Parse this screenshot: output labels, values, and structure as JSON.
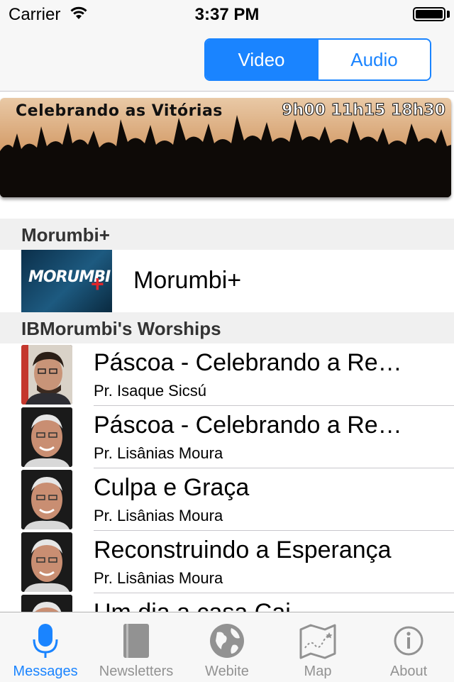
{
  "status_bar": {
    "carrier": "Carrier",
    "time": "3:37 PM"
  },
  "nav": {
    "segments": [
      "Video",
      "Audio"
    ],
    "selected": "Video"
  },
  "banner": {
    "title": "Celebrando as Vitórias",
    "times": "9h00 11h15 18h30"
  },
  "sections": [
    {
      "header": "Morumbi+",
      "items": [
        {
          "title": "Morumbi+",
          "thumb_text": "MORUMBI"
        }
      ]
    },
    {
      "header": "IBMorumbi's Worships",
      "items": [
        {
          "title": "Páscoa - Celebrando a Re…",
          "speaker": "Pr. Isaque Sicsú"
        },
        {
          "title": "Páscoa - Celebrando a Re…",
          "speaker": "Pr. Lisânias Moura"
        },
        {
          "title": "Culpa e Graça",
          "speaker": "Pr. Lisânias Moura"
        },
        {
          "title": "Reconstruindo a Esperança",
          "speaker": "Pr. Lisânias Moura"
        },
        {
          "title": "Um dia a casa Cai",
          "speaker": ""
        }
      ]
    }
  ],
  "tab_bar": {
    "items": [
      {
        "label": "Messages",
        "icon": "microphone-icon",
        "active": true
      },
      {
        "label": "Newsletters",
        "icon": "book-icon",
        "active": false
      },
      {
        "label": "Webite",
        "icon": "globe-icon",
        "active": false
      },
      {
        "label": "Map",
        "icon": "map-icon",
        "active": false
      },
      {
        "label": "About",
        "icon": "info-icon",
        "active": false
      }
    ]
  },
  "colors": {
    "accent": "#1a84ff",
    "tab_inactive": "#929292"
  }
}
